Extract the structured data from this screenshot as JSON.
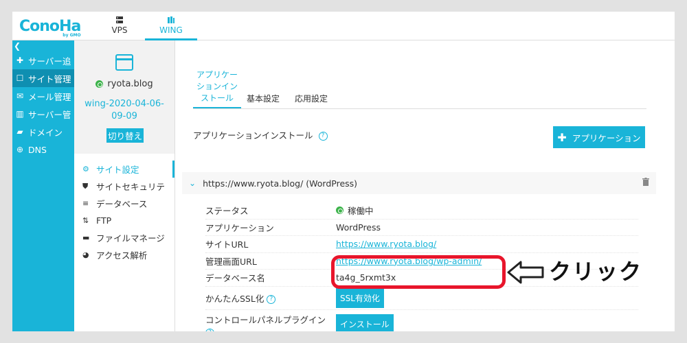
{
  "brand": {
    "logo": "ConoHa",
    "logo_sub": "by GMO"
  },
  "top_tabs": [
    {
      "label": "VPS"
    },
    {
      "label": "WING"
    }
  ],
  "sidebar": {
    "collapse": "❮",
    "items": [
      {
        "label": "サーバー追"
      },
      {
        "label": "サイト管理"
      },
      {
        "label": "メール管理"
      },
      {
        "label": "サーバー管"
      },
      {
        "label": "ドメイン"
      },
      {
        "label": "DNS"
      }
    ]
  },
  "site": {
    "name": "ryota.blog",
    "server": "wing-2020-04-06-09-09",
    "switch_label": "切り替え"
  },
  "sub_menu": [
    {
      "label": "サイト設定"
    },
    {
      "label": "サイトセキュリテ"
    },
    {
      "label": "データベース"
    },
    {
      "label": "FTP"
    },
    {
      "label": "ファイルマネージ"
    },
    {
      "label": "アクセス解析"
    }
  ],
  "main": {
    "tabs": [
      {
        "label": "アプリケーションインストール"
      },
      {
        "label": "基本設定"
      },
      {
        "label": "応用設定"
      }
    ],
    "section_title": "アプリケーションインストール",
    "help": "?",
    "add_app_label": "アプリケーション",
    "accordion_title": "https://www.ryota.blog/ (WordPress)",
    "rows": {
      "status_key": "ステータス",
      "status_val": "稼働中",
      "app_key": "アプリケーション",
      "app_val": "WordPress",
      "site_url_key": "サイトURL",
      "site_url_val": "https://www.ryota.blog/",
      "admin_url_key": "管理画面URL",
      "admin_url_val": "https://www.ryota.blog/wp-admin/",
      "db_key": "データベース名",
      "db_val": "ta4g_5rxmt3x",
      "ssl_key": "かんたんSSL化",
      "ssl_btn": "SSL有効化",
      "plugin_key": "コントロールパネルプラグイン",
      "install_btn": "インストール"
    }
  },
  "annotation": {
    "label": "クリック",
    "color": "#e8152b"
  },
  "colors": {
    "accent": "#19b4d8",
    "sidebar_active": "#0f8fb1",
    "status_ok": "#3cb34a"
  }
}
